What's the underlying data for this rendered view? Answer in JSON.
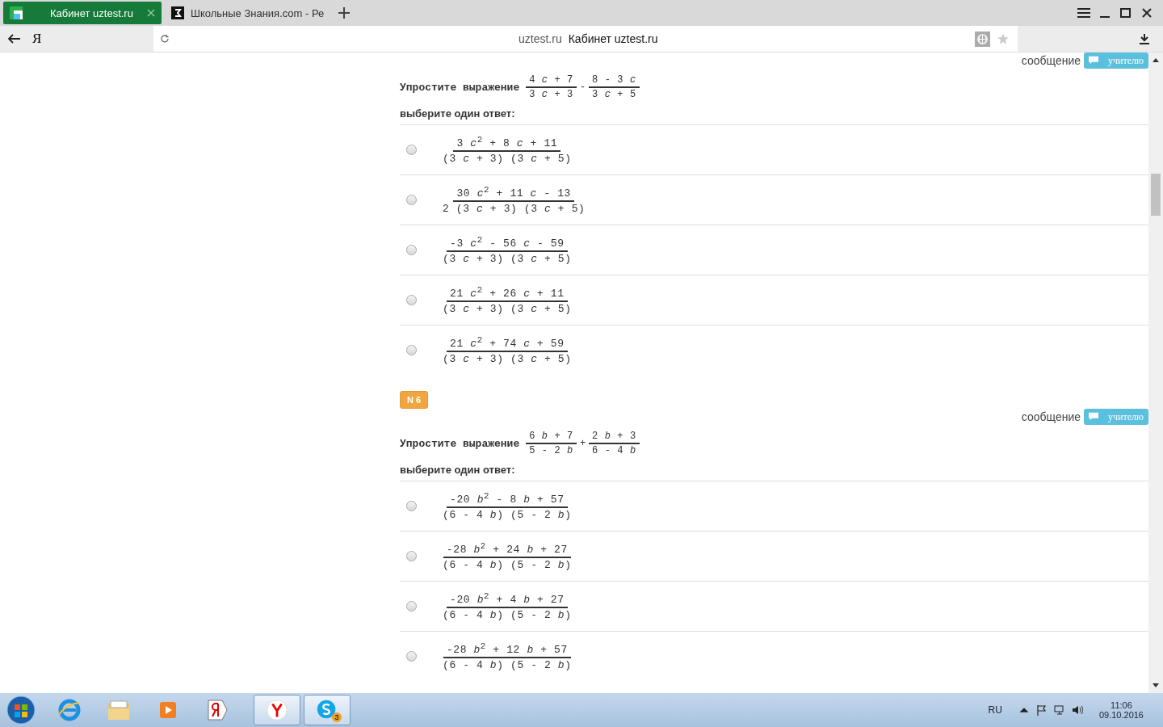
{
  "browser": {
    "tabs": [
      {
        "title": "Кабинет uztest.ru",
        "selected": true
      },
      {
        "title": "Школьные Знания.com - Ре",
        "selected": false
      }
    ],
    "yandex_button": "Я",
    "address": {
      "domain": "uztest.ru",
      "title": "Кабинет uztest.ru"
    }
  },
  "questions": [
    {
      "message_label": "сообщение",
      "teacher_button": "учителю",
      "prompt": "Упростите выражение",
      "operator": "-",
      "fractions": [
        {
          "num": "4 *c* + 7",
          "den": "3 *c* + 3"
        },
        {
          "num": "8 - 3 *c*",
          "den": "3 *c* + 5"
        }
      ],
      "choose_label": "выберите один ответ:",
      "answers": [
        {
          "num": "3 *c*$^{2}$ + 8 *c* + 11",
          "den": "(3 *c* + 3) (3 *c* + 5)",
          "selected": false
        },
        {
          "num": "30 *c*$^{2}$ + 11 *c* - 13",
          "den": "2 (3 *c* + 3) (3 *c* + 5)",
          "selected": false
        },
        {
          "num": "-3 *c*$^{2}$ - 56 *c* - 59",
          "den": "(3 *c* + 3) (3 *c* + 5)",
          "selected": false
        },
        {
          "num": "21 *c*$^{2}$ + 26 *c* + 11",
          "den": "(3 *c* + 3) (3 *c* + 5)",
          "selected": false
        },
        {
          "num": "21 *c*$^{2}$ + 74 *c* + 59",
          "den": "(3 *c* + 3) (3 *c* + 5)",
          "selected": false
        }
      ]
    },
    {
      "number": "N 6",
      "message_label": "сообщение",
      "teacher_button": "учителю",
      "prompt": "Упростите выражение",
      "operator": "+",
      "fractions": [
        {
          "num": "6 *b* + 7",
          "den": "5 - 2 *b*"
        },
        {
          "num": "2 *b* + 3",
          "den": "6 - 4 *b*"
        }
      ],
      "choose_label": "выберите один ответ:",
      "answers": [
        {
          "num": "-20 *b*$^{2}$ - 8 *b* + 57",
          "den": "(6 - 4 *b*) (5 - 2 *b*)",
          "selected": false
        },
        {
          "num": "-28 *b*$^{2}$ + 24 *b* + 27",
          "den": "(6 - 4 *b*) (5 - 2 *b*)",
          "selected": false
        },
        {
          "num": "-20 *b*$^{2}$ + 4 *b* + 27",
          "den": "(6 - 4 *b*) (5 - 2 *b*)",
          "selected": false
        },
        {
          "num": "-28 *b*$^{2}$ + 12 *b* + 57",
          "den": "(6 - 4 *b*) (5 - 2 *b*)",
          "selected": false
        }
      ]
    }
  ],
  "taskbar": {
    "skype_badge": "3",
    "language": "RU",
    "time": "11:06",
    "date": "09.10.2016"
  }
}
